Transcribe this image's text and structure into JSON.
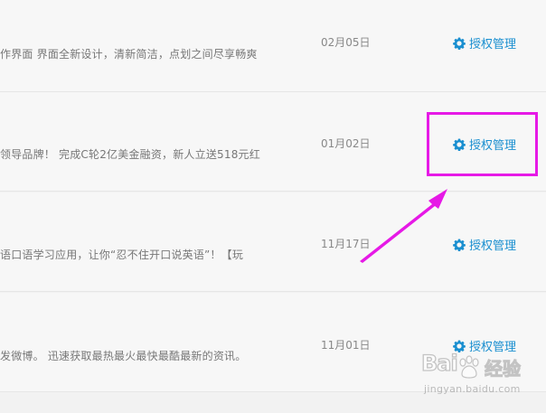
{
  "rows": [
    {
      "description": "作界面 界面全新设计，清新简洁，点划之间尽享畅爽",
      "date": "02月05日",
      "action": "授权管理"
    },
    {
      "description": "领导品牌！ 完成C轮2亿美金融资，新人立送518元红",
      "date": "01月02日",
      "action": "授权管理"
    },
    {
      "description": "语口语学习应用，让你“忍不住开口说英语”！【玩",
      "date": "11月17日",
      "action": "授权管理"
    },
    {
      "description": "发微博。 迅速获取最热最火最快最酷最新的资讯。",
      "date": "11月01日",
      "action": "授权管理"
    }
  ],
  "watermark": {
    "logo": "Bai",
    "logo_cn": "经验",
    "url": "jingyan.baidu.com"
  },
  "icons": {
    "action_icon": "gear-icon"
  },
  "colors": {
    "link": "#1a8fd0",
    "highlight": "#e619e6"
  }
}
